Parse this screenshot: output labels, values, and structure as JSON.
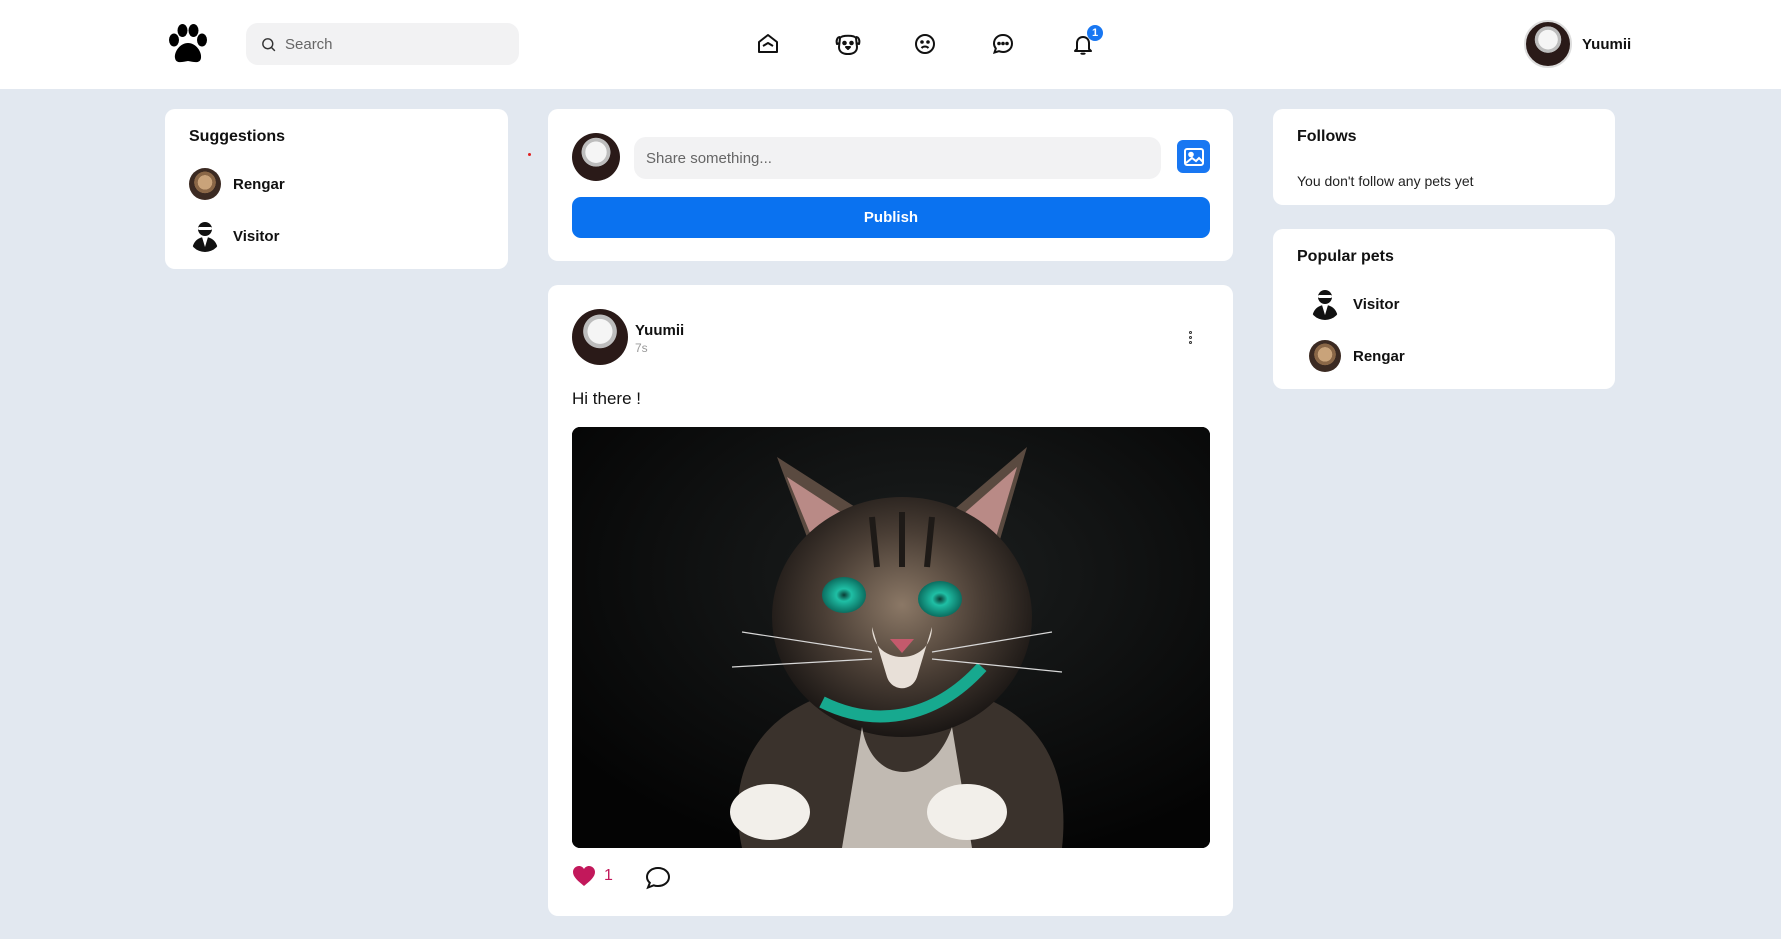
{
  "header": {
    "search": {
      "placeholder": "Search",
      "value": ""
    },
    "nav_icons": [
      "home-icon",
      "dog-icon",
      "emoji-icon",
      "messages-icon",
      "bell-icon"
    ],
    "notification_count": "1",
    "user": {
      "name": "Yuumii"
    }
  },
  "suggestions": {
    "title": "Suggestions",
    "items": [
      {
        "name": "Rengar"
      },
      {
        "name": "Visitor"
      }
    ]
  },
  "composer": {
    "placeholder": "Share something...",
    "publish_label": "Publish"
  },
  "post": {
    "author": "Yuumii",
    "time": "7s",
    "text": "Hi there !",
    "likes": "1"
  },
  "follows": {
    "title": "Follows",
    "empty_text": "You don't follow any pets yet"
  },
  "popular": {
    "title": "Popular pets",
    "items": [
      {
        "name": "Visitor"
      },
      {
        "name": "Rengar"
      }
    ]
  },
  "colors": {
    "background": "#e2e8f0",
    "accent": "#0a72f0",
    "like": "#c2185b"
  }
}
